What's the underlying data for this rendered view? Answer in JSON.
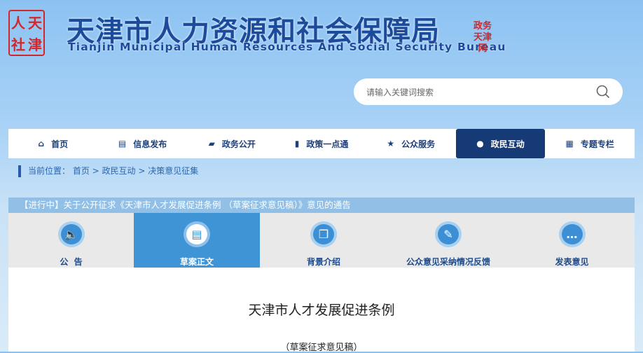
{
  "header": {
    "logo_chars": [
      "人",
      "天",
      "社",
      "津"
    ],
    "title": "天津市人力资源和社会保障局",
    "subtitle": "Tianjin Municipal Human Resources And Social Security Bureau",
    "stamp": "政务天津网"
  },
  "search": {
    "placeholder": "请输入关键词搜索"
  },
  "nav": [
    {
      "label": "首页",
      "icon": "⌂"
    },
    {
      "label": "信息发布",
      "icon": "▤"
    },
    {
      "label": "政务公开",
      "icon": "▰"
    },
    {
      "label": "政策一点通",
      "icon": "▮"
    },
    {
      "label": "公众服务",
      "icon": "★"
    },
    {
      "label": "政民互动",
      "icon": "●"
    },
    {
      "label": "专题专栏",
      "icon": "▦"
    }
  ],
  "breadcrumb": {
    "prefix": "当前位置：",
    "items": [
      "首页",
      "政民互动",
      "决策意见征集"
    ],
    "sep": " > "
  },
  "notice": "【进行中】关于公开征求《天津市人才发展促进条例 （草案征求意见稿）》意见的通告",
  "tabs": [
    {
      "label": "公  告",
      "icon": "🔈"
    },
    {
      "label": "草案正文",
      "icon": "▤"
    },
    {
      "label": "背景介绍",
      "icon": "❐"
    },
    {
      "label": "公众意见采纳情况反馈",
      "icon": "✎"
    },
    {
      "label": "发表意见",
      "icon": "…"
    }
  ],
  "document": {
    "title": "天津市人才发展促进条例",
    "subtitle": "（草案征求意见稿）"
  }
}
